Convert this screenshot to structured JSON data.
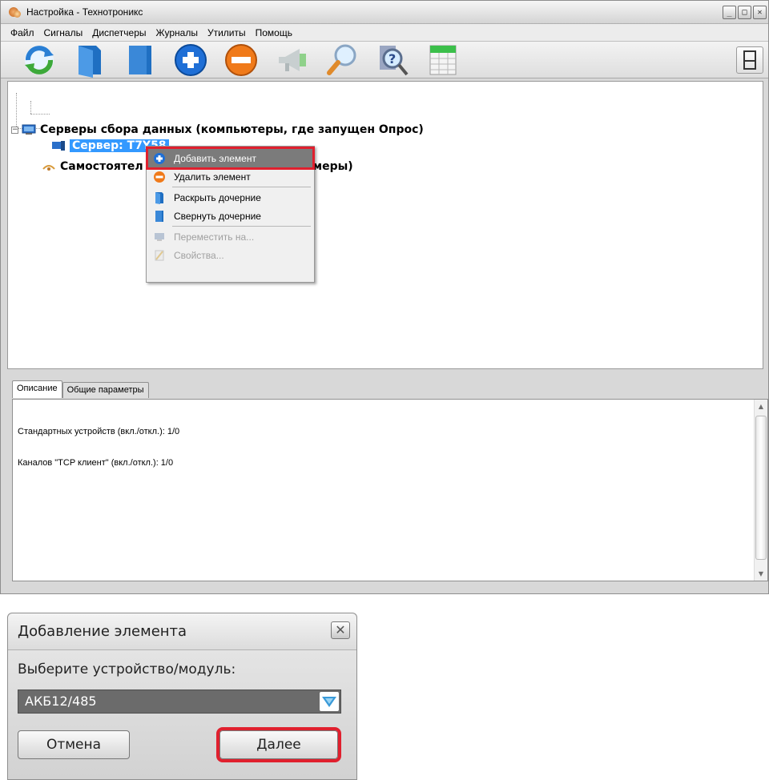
{
  "window": {
    "title": "Настройка - Технотроникс",
    "controls": {
      "minimize": "_",
      "maximize": "□",
      "close": "✕"
    }
  },
  "menu": [
    "Файл",
    "Сигналы",
    "Диспетчеры",
    "Журналы",
    "Утилиты",
    "Помощь"
  ],
  "toolbar": {
    "icons": [
      "refresh-icon",
      "folder-expand-icon",
      "folder-collapse-icon",
      "add-icon",
      "remove-icon",
      "megaphone-icon",
      "search-icon",
      "help-search-icon",
      "spreadsheet-icon"
    ],
    "right_icon": "panel-icon"
  },
  "tree": {
    "root1": "Серверы сбора данных (компьютеры, где запущен Опрос)",
    "child1": "Сервер: T7Y58",
    "root2_visible_start": "Самостоятел",
    "root2_visible_end": "меры)"
  },
  "context_menu": {
    "items": [
      {
        "label": "Добавить элемент",
        "icon": "add-icon",
        "state": "highlighted"
      },
      {
        "label": "Удалить элемент",
        "icon": "remove-icon",
        "state": "normal"
      },
      {
        "label": "Раскрыть дочерние",
        "icon": "folder-expand-icon",
        "state": "normal"
      },
      {
        "label": "Свернуть дочерние",
        "icon": "folder-collapse-icon",
        "state": "normal"
      },
      {
        "label": "Переместить на...",
        "icon": "move-icon",
        "state": "disabled"
      },
      {
        "label": "Свойства...",
        "icon": "properties-icon",
        "state": "disabled"
      }
    ]
  },
  "tabs": [
    "Описание",
    "Общие параметры"
  ],
  "description": {
    "line1": "Стандартных устройств (вкл./откл.): 1/0",
    "line2": "Каналов \"TCP клиент\" (вкл./откл.): 1/0"
  },
  "dialog": {
    "title": "Добавление элемента",
    "close": "✕",
    "label": "Выберите устройство/модуль:",
    "selected": "АКБ12/485",
    "cancel": "Отмена",
    "next": "Далее"
  },
  "colors": {
    "highlight_outline": "#e0202e",
    "selection": "#3399ff",
    "menu_highlight": "#7b7b7b"
  }
}
